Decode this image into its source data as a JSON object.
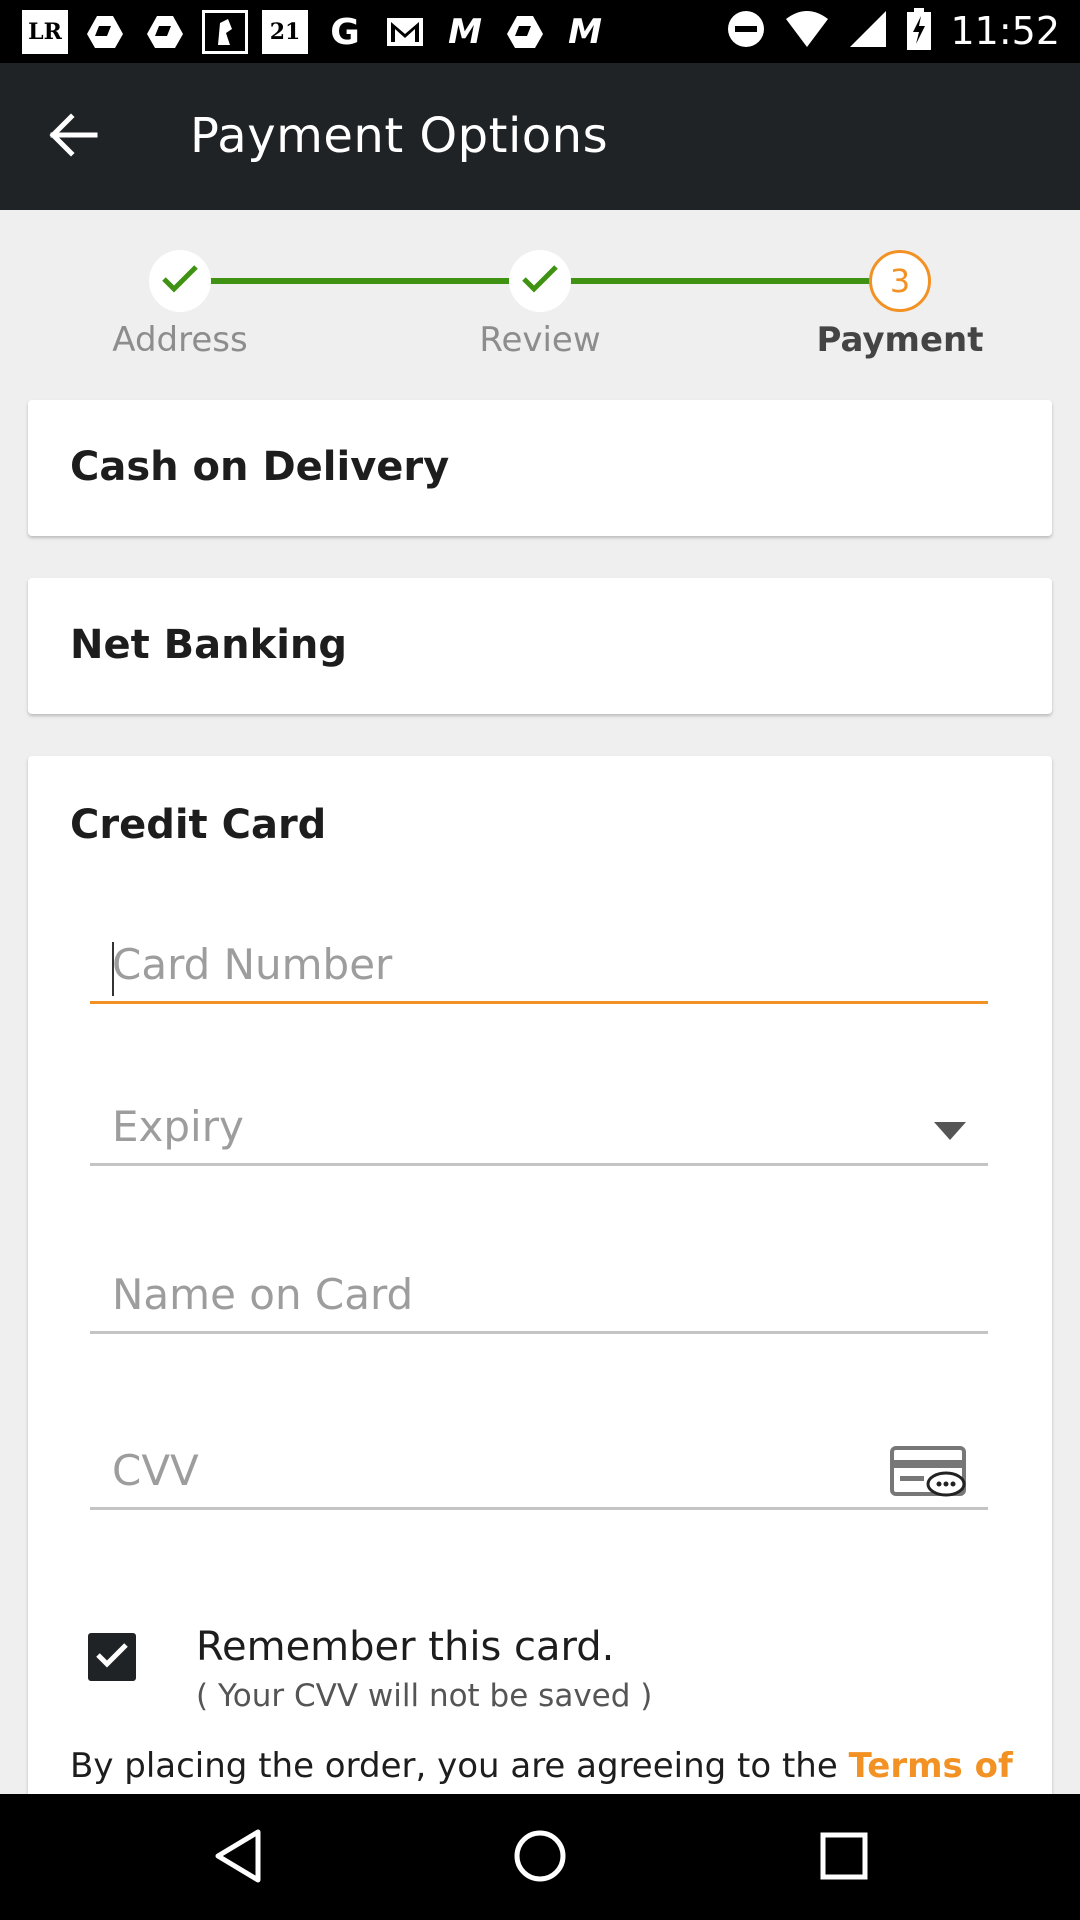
{
  "status_bar": {
    "time": "11:52",
    "notification_icons": [
      "LR",
      "drive",
      "drive",
      "mirror",
      "21",
      "G",
      "gmail",
      "M",
      "drive",
      "M"
    ],
    "notif_labels": {
      "lr": "LR",
      "f21": "21",
      "g": "G",
      "m": "M"
    }
  },
  "appbar": {
    "title": "Payment Options",
    "back_icon": "arrow-left-icon"
  },
  "stepper": {
    "steps": [
      {
        "label": "Address",
        "state": "done"
      },
      {
        "label": "Review",
        "state": "done"
      },
      {
        "label": "Payment",
        "state": "current",
        "number": "3"
      }
    ],
    "done_color": "#3f9212",
    "current_color": "#f39224"
  },
  "payment_options": {
    "cash_on_delivery": "Cash on Delivery",
    "net_banking": "Net Banking",
    "credit_card": {
      "title": "Credit Card",
      "card_number_placeholder": "Card Number",
      "expiry_placeholder": "Expiry",
      "name_placeholder": "Name on Card",
      "cvv_placeholder": "CVV",
      "remember_label": "Remember this card.",
      "remember_note": "( Your CVV will not be saved )",
      "remember_checked": true,
      "terms_prefix": "By placing the order, you are agreeing to the",
      "terms_link": "Terms of"
    }
  },
  "colors": {
    "accent": "#f39224",
    "appbar": "#1f2326",
    "background": "#efefef"
  },
  "nav_bar": {
    "icons": [
      "back-triangle-icon",
      "home-circle-icon",
      "recents-square-icon"
    ]
  }
}
